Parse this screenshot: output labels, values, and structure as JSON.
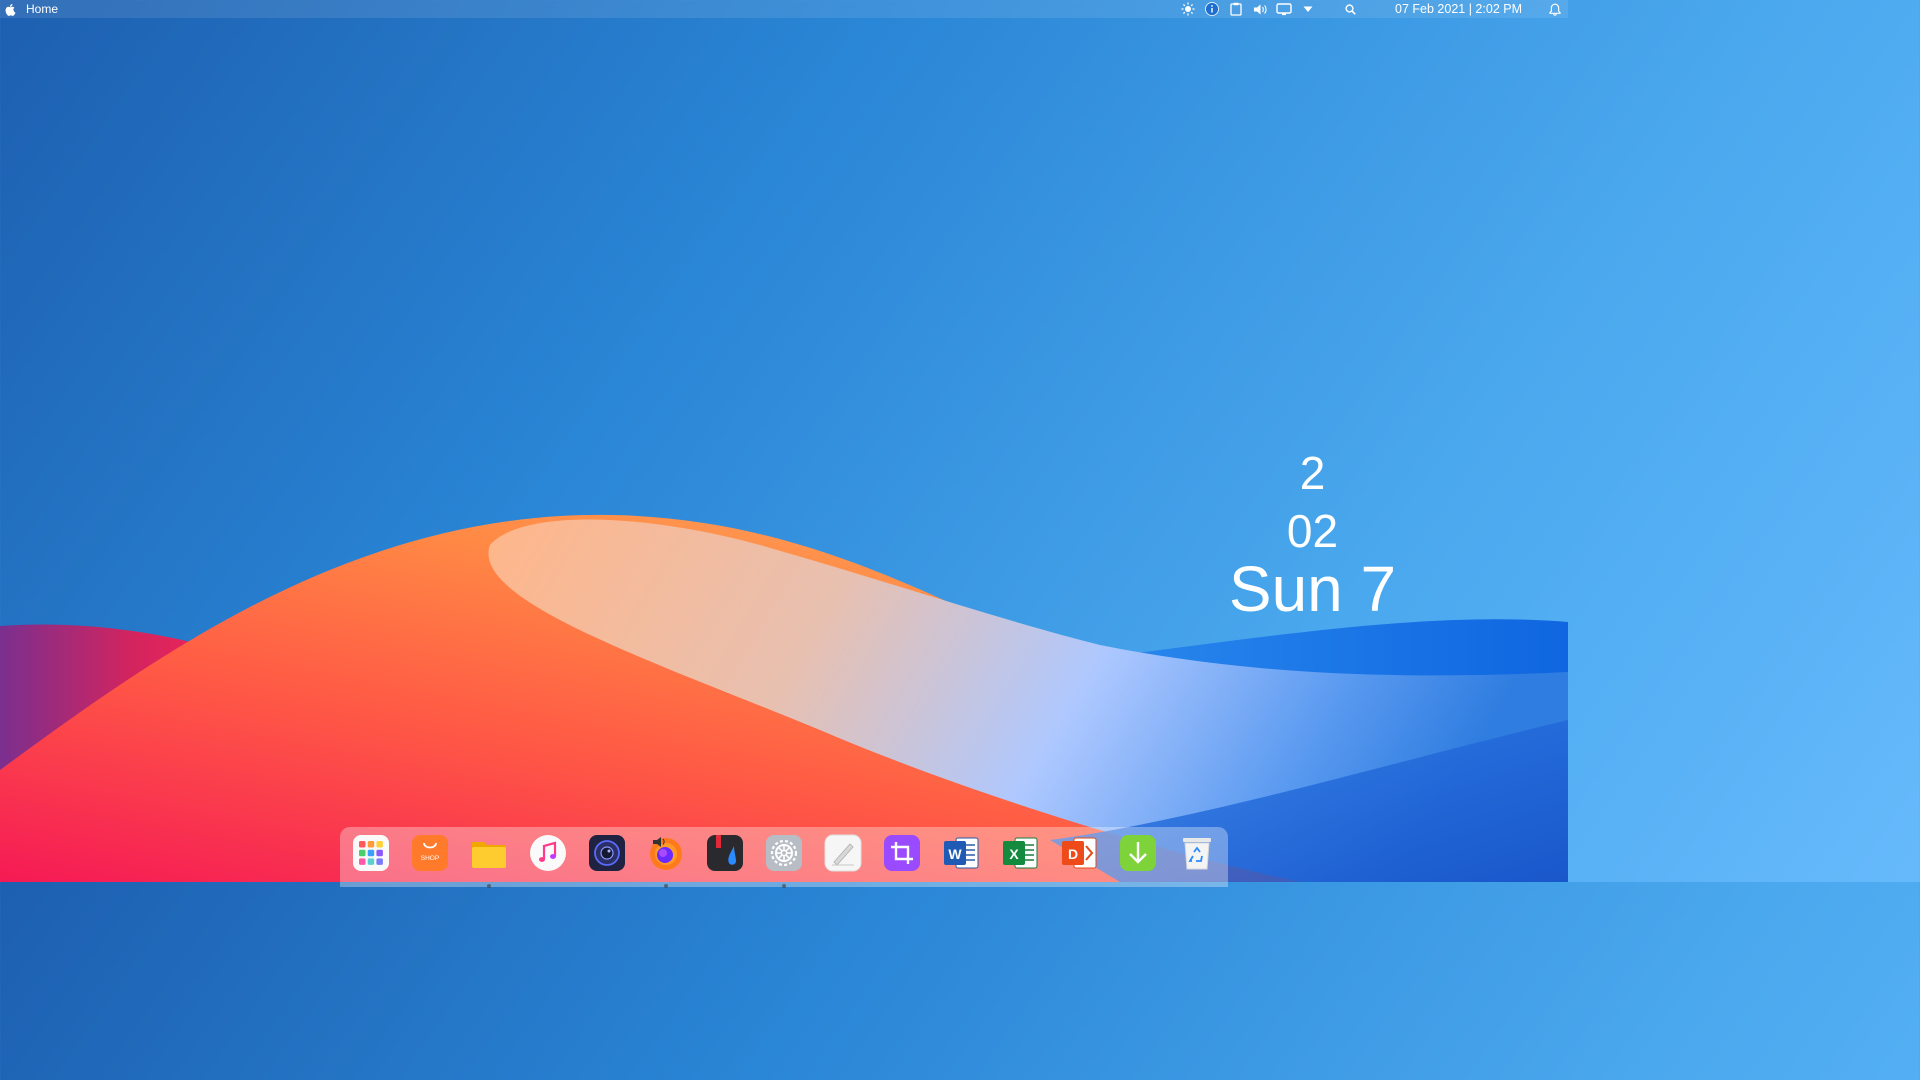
{
  "topbar": {
    "app_title": "Home",
    "datetime": "07 Feb 2021 | 2:02 PM",
    "tray_icons": [
      "brightness-icon",
      "info-icon",
      "clipboard-icon",
      "volume-icon",
      "display-icon",
      "dropdown-arrow-icon",
      "search-icon",
      "notification-bell-icon"
    ]
  },
  "widget": {
    "hour": "2",
    "minute": "02",
    "day": "Sun 7"
  },
  "dock": {
    "apps": [
      {
        "name": "launcher",
        "icon": "app-grid-icon"
      },
      {
        "name": "shop",
        "icon": "shop-icon",
        "label": "SHOP"
      },
      {
        "name": "files",
        "icon": "folder-icon",
        "running": true
      },
      {
        "name": "music",
        "icon": "music-note-icon"
      },
      {
        "name": "camera",
        "icon": "camera-icon"
      },
      {
        "name": "firefox",
        "icon": "firefox-icon",
        "running": true
      },
      {
        "name": "text-editor",
        "icon": "ink-drop-icon"
      },
      {
        "name": "settings",
        "icon": "gear-icon",
        "running": true
      },
      {
        "name": "notes",
        "icon": "pen-icon"
      },
      {
        "name": "screenshot",
        "icon": "crop-icon"
      },
      {
        "name": "word",
        "icon": "word-icon",
        "label": "W"
      },
      {
        "name": "excel",
        "icon": "excel-icon",
        "label": "X"
      },
      {
        "name": "office",
        "icon": "office-icon",
        "label": "D"
      },
      {
        "name": "downloader",
        "icon": "download-arrow-icon"
      },
      {
        "name": "trash",
        "icon": "recycle-bin-icon"
      }
    ]
  },
  "colors": {
    "sky_top": "#1d5fb0",
    "sky_right": "#66bafc",
    "dune_orange": "#ff7a45",
    "dune_red": "#f0245a",
    "dune_highlight": "#aec8ff"
  }
}
